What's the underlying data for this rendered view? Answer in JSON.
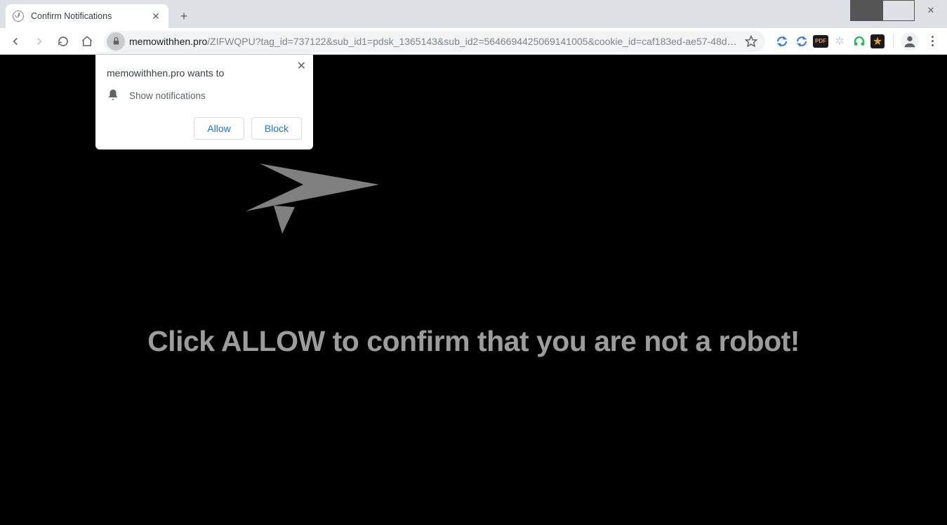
{
  "tab": {
    "title": "Confirm Notifications"
  },
  "url": {
    "domain": "memowithhen.pro",
    "path": "/ZIFWQPU?tag_id=737122&sub_id1=pdsk_1365143&sub_id2=5646694425069141005&cookie_id=caf183ed-ae57-48dd..."
  },
  "extensions": {
    "pdf_label": "PDF"
  },
  "permission": {
    "title": "memowithhen.pro wants to",
    "body": "Show notifications",
    "allow": "Allow",
    "block": "Block"
  },
  "page": {
    "main_text": "Click ALLOW to confirm that you are not a robot!"
  }
}
